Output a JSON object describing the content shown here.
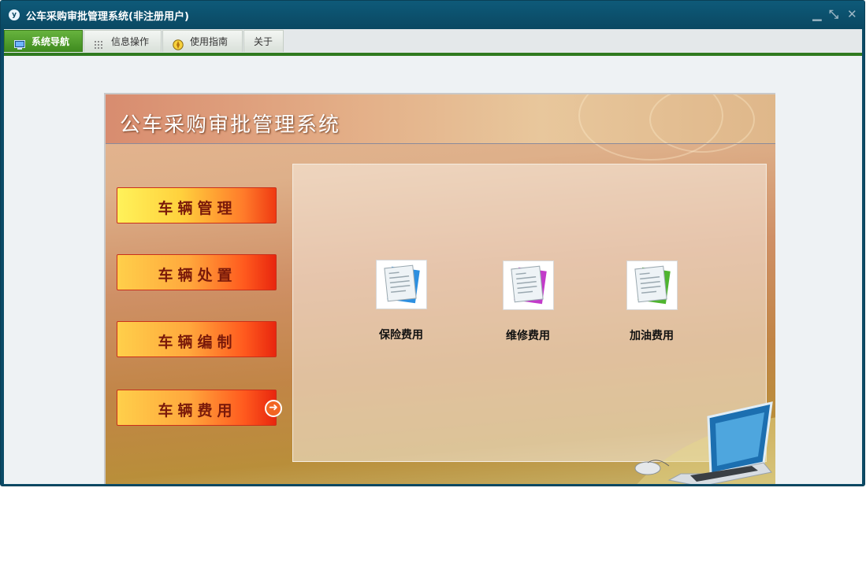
{
  "window": {
    "title": "公车采购审批管理系统(非注册用户)"
  },
  "tabs": [
    {
      "label": "系统导航",
      "icon": "monitor-icon"
    },
    {
      "label": "信息操作",
      "icon": "grid-icon"
    },
    {
      "label": "使用指南",
      "icon": "compass-icon"
    },
    {
      "label": "关于",
      "icon": ""
    }
  ],
  "panel": {
    "title": "公车采购审批管理系统",
    "menu": [
      {
        "label": "车辆管理"
      },
      {
        "label": "车辆处置"
      },
      {
        "label": "车辆编制"
      },
      {
        "label": "车辆费用"
      }
    ],
    "items": [
      {
        "label": "保险费用",
        "color": "#2c8fe0"
      },
      {
        "label": "维修费用",
        "color": "#c23bc9"
      },
      {
        "label": "加油费用",
        "color": "#4fb52f"
      }
    ]
  },
  "colors": {
    "titlebar": "#0a4862",
    "active_tab": "#4f9d2a",
    "accent_line": "#2f7a1f"
  }
}
